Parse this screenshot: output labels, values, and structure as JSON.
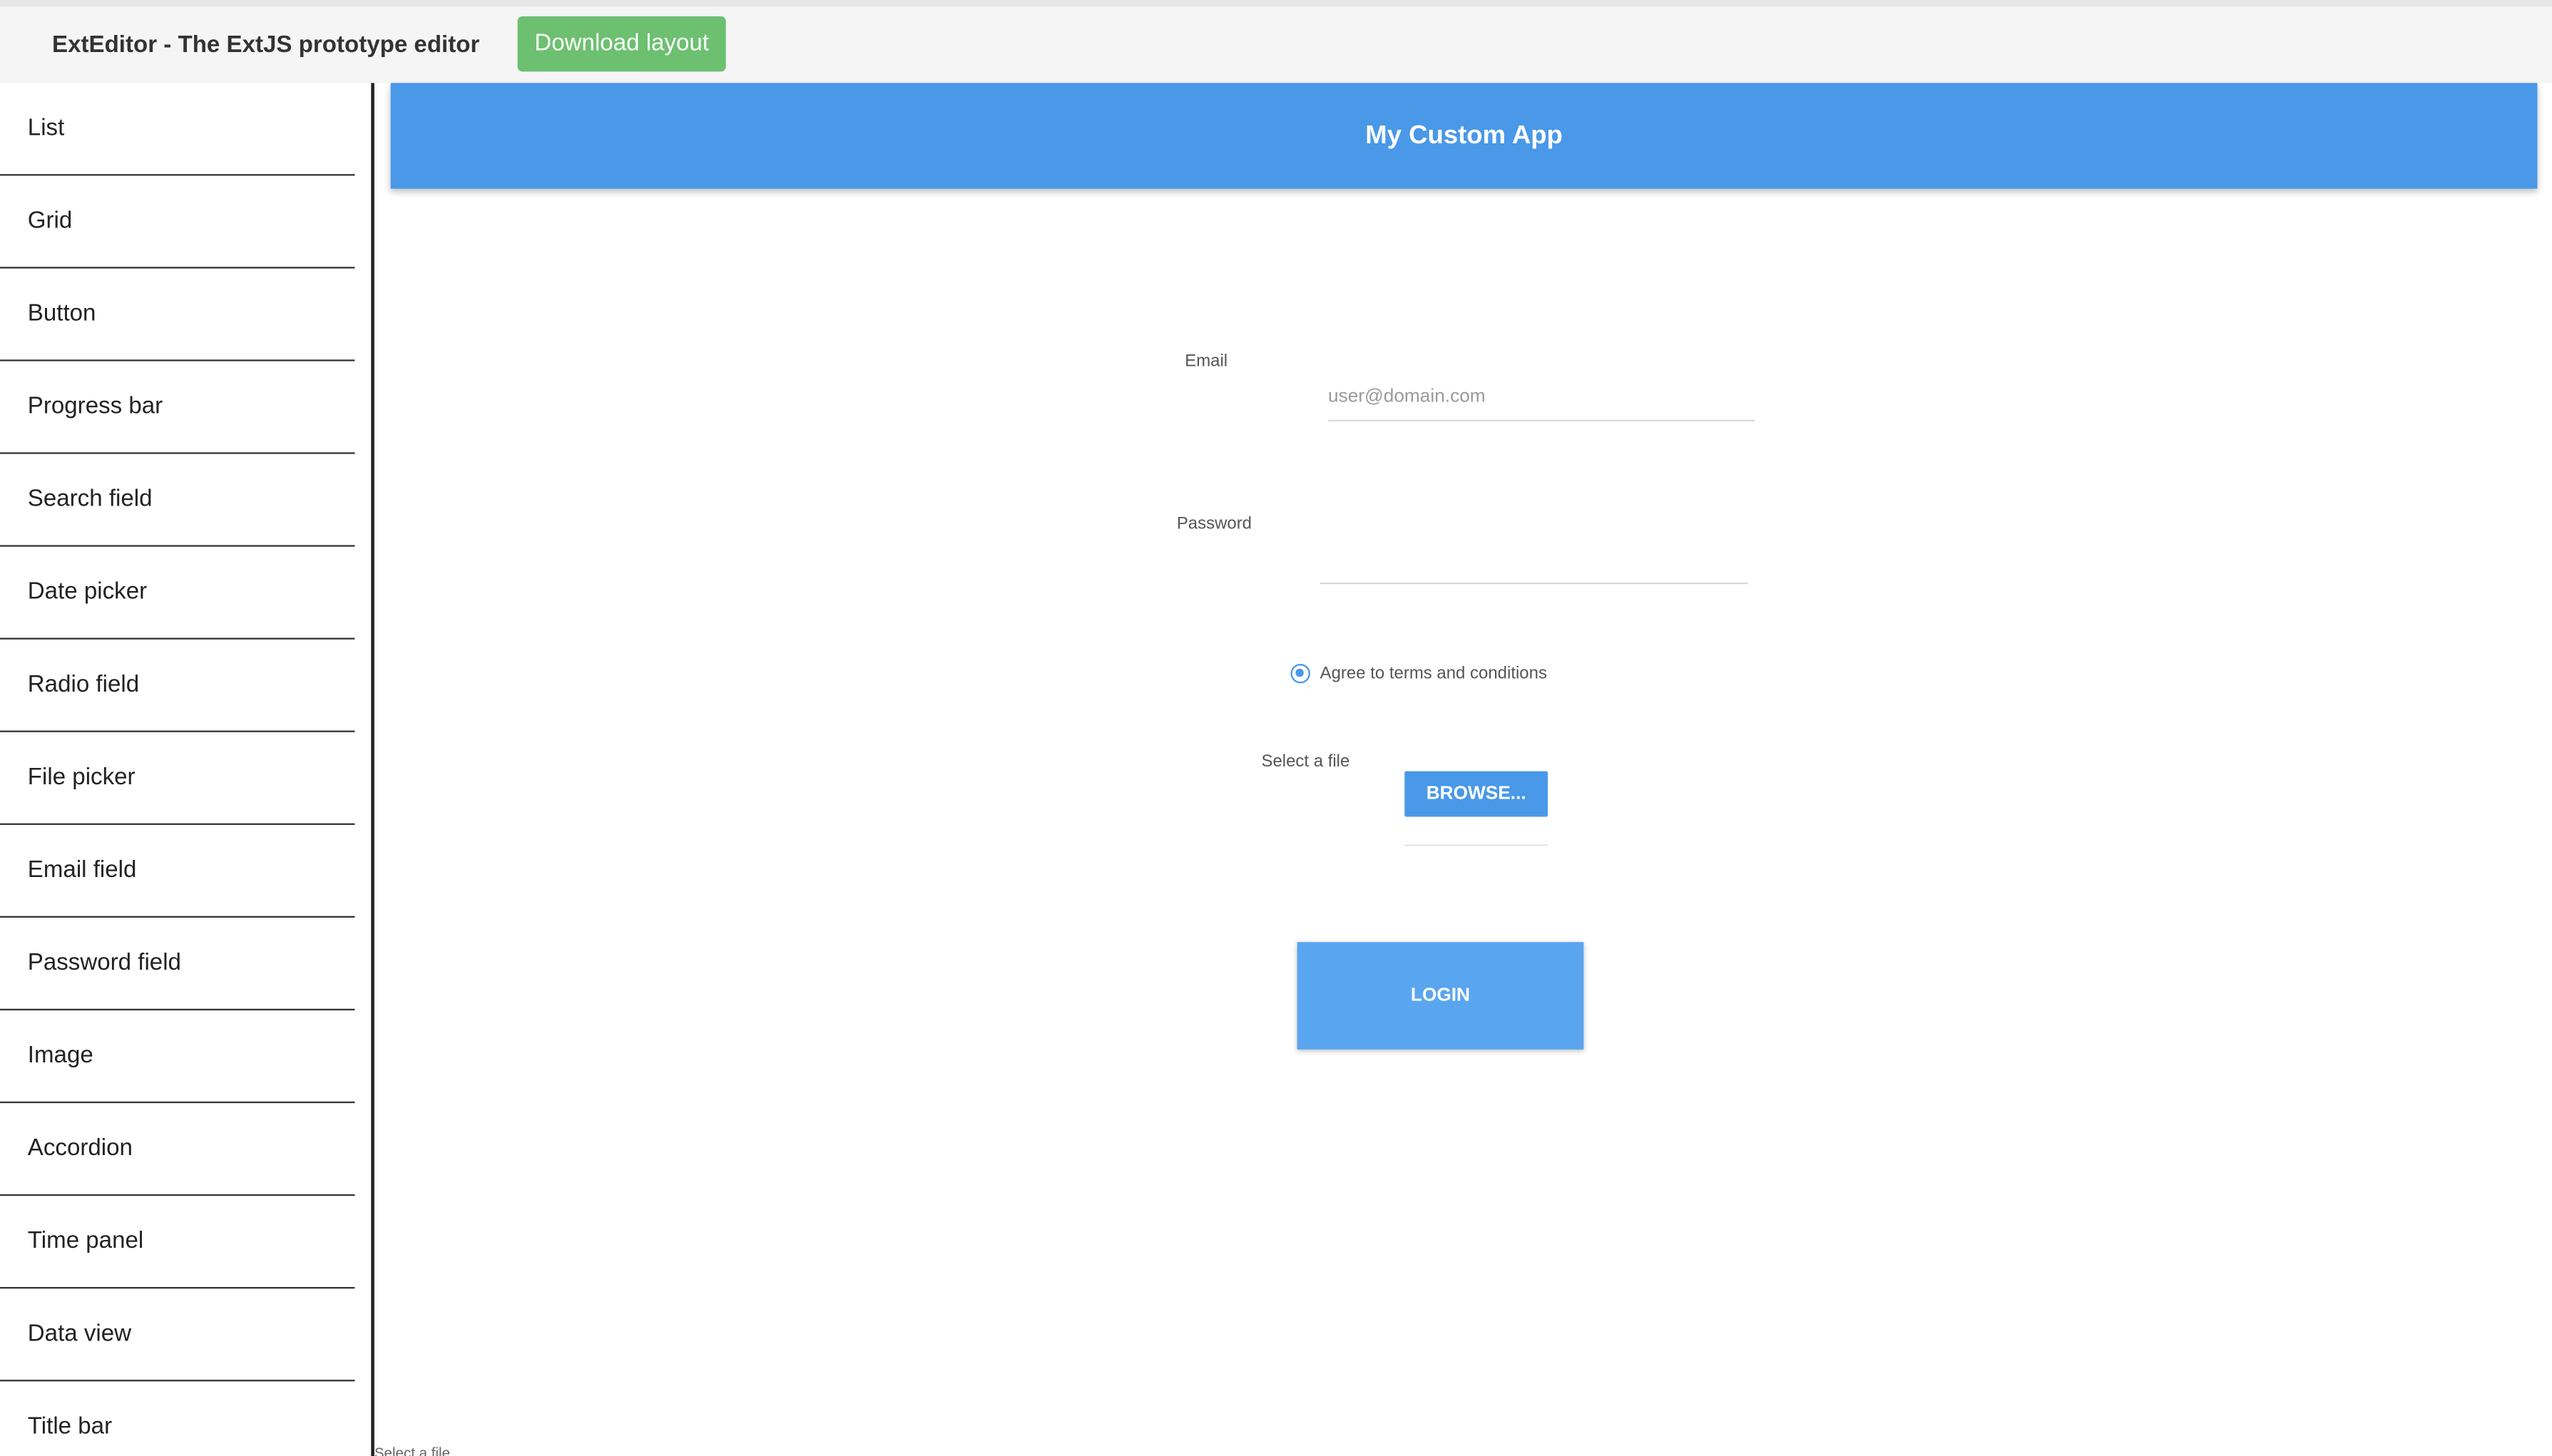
{
  "topbar": {
    "title": "ExtEditor - The ExtJS prototype editor",
    "download_label": "Download layout"
  },
  "sidebar": {
    "items": [
      {
        "label": "List"
      },
      {
        "label": "Grid"
      },
      {
        "label": "Button"
      },
      {
        "label": "Progress bar"
      },
      {
        "label": "Search field"
      },
      {
        "label": "Date picker"
      },
      {
        "label": "Radio field"
      },
      {
        "label": "File picker"
      },
      {
        "label": "Email field"
      },
      {
        "label": "Password field"
      },
      {
        "label": "Image"
      },
      {
        "label": "Accordion"
      },
      {
        "label": "Time panel"
      },
      {
        "label": "Data view"
      },
      {
        "label": "Title bar"
      }
    ]
  },
  "canvas": {
    "header_title": "My Custom App",
    "email_label": "Email",
    "email_placeholder": "user@domain.com",
    "email_value": "",
    "password_label": "Password",
    "password_value": "",
    "radio_label": "Agree to terms and conditions",
    "file_label": "Select a file",
    "browse_label": "BROWSE...",
    "login_label": "LOGIN",
    "footer_hint": "Select a file"
  },
  "colors": {
    "primary": "#4a98e8",
    "download": "#6cc070",
    "login": "#5aa5ef"
  },
  "icons": {
    "radio": "radio-selected-icon"
  }
}
